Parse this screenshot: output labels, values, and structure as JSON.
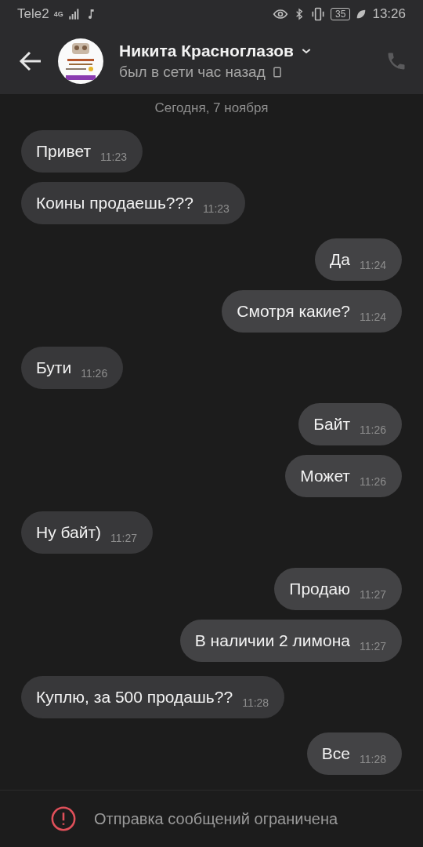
{
  "status_bar": {
    "carrier": "Tele2",
    "network": "4G",
    "battery": "35",
    "time": "13:26"
  },
  "header": {
    "name": "Никита Красноглазов",
    "status": "был в сети час назад"
  },
  "date_divider": "Сегодня, 7 ноября",
  "messages": [
    {
      "kind": "incoming",
      "text": "Привет",
      "time": "11:23"
    },
    {
      "kind": "incoming",
      "text": "Коины продаешь???",
      "time": "11:23"
    },
    {
      "kind": "outgoing",
      "text": "Да",
      "time": "11:24"
    },
    {
      "kind": "outgoing",
      "text": "Смотря какие?",
      "time": "11:24"
    },
    {
      "kind": "incoming",
      "text": "Бути",
      "time": "11:26"
    },
    {
      "kind": "outgoing",
      "text": "Байт",
      "time": "11:26"
    },
    {
      "kind": "outgoing",
      "text": "Может",
      "time": "11:26"
    },
    {
      "kind": "incoming",
      "text": "Ну байт)",
      "time": "11:27"
    },
    {
      "kind": "outgoing",
      "text": "Продаю",
      "time": "11:27"
    },
    {
      "kind": "outgoing",
      "text": "В наличии 2 лимона",
      "time": "11:27"
    },
    {
      "kind": "incoming",
      "text": "Куплю, за 500 продашь??",
      "time": "11:28"
    },
    {
      "kind": "outgoing",
      "text": "Все",
      "time": "11:28"
    }
  ],
  "footer": {
    "notice": "Отправка сообщений ограничена"
  }
}
